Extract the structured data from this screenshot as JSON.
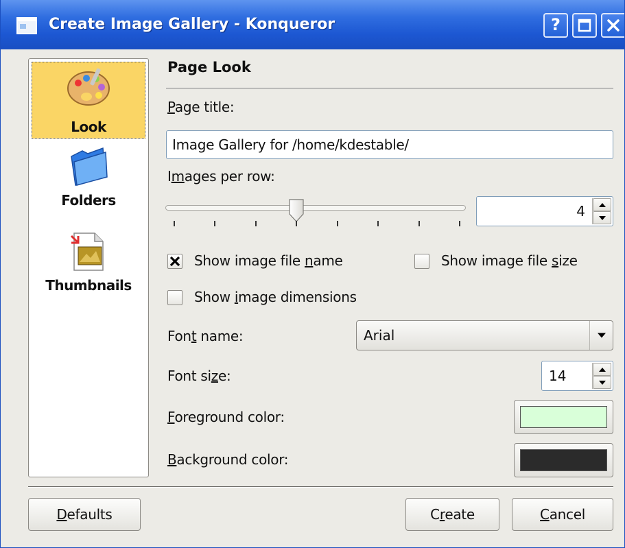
{
  "window": {
    "title": "Create Image Gallery - Konqueror",
    "help_label": "?"
  },
  "sidebar": {
    "items": [
      {
        "label": "Look",
        "icon": "palette-icon",
        "selected": true
      },
      {
        "label": "Folders",
        "icon": "folder-icon",
        "selected": false
      },
      {
        "label": "Thumbnails",
        "icon": "thumbnails-icon",
        "selected": false
      }
    ]
  },
  "page": {
    "section_title": "Page Look",
    "page_title_label": {
      "accel": "P",
      "rest": "age title:"
    },
    "page_title_value": "Image Gallery for /home/kdestable/",
    "images_per_row_label": {
      "pre": "I",
      "accel": "m",
      "rest": "ages per row:"
    },
    "images_per_row_value": "4",
    "images_per_row_slider_fraction": 0.33,
    "show_file_name": {
      "pre": "Show image file ",
      "accel": "n",
      "rest": "ame",
      "checked": true
    },
    "show_file_size": {
      "pre": "Show image file ",
      "accel": "s",
      "rest": "ize",
      "checked": false
    },
    "show_dimensions": {
      "pre": "Show ",
      "accel": "i",
      "rest": "mage dimensions",
      "checked": false
    },
    "font_name_label": {
      "pre": "Fon",
      "accel": "t",
      "rest": " name:"
    },
    "font_name_value": "Arial",
    "font_size_label": {
      "pre": "Font si",
      "accel": "z",
      "rest": "e:"
    },
    "font_size_value": "14",
    "foreground_label": {
      "accel": "F",
      "rest": "oreground color:"
    },
    "foreground_color": "#d9ffd9",
    "background_label": {
      "accel": "B",
      "rest": "ackground color:"
    },
    "background_color": "#2b2b2b"
  },
  "buttons": {
    "defaults": {
      "accel": "D",
      "rest": "efaults"
    },
    "create": {
      "pre": "C",
      "accel": "r",
      "rest": "eate"
    },
    "cancel": {
      "accel": "C",
      "rest": "ancel"
    }
  },
  "colors": {
    "titlebar": "#2462d8",
    "selection": "#fad565",
    "dialog_bg": "#ecebe6"
  }
}
